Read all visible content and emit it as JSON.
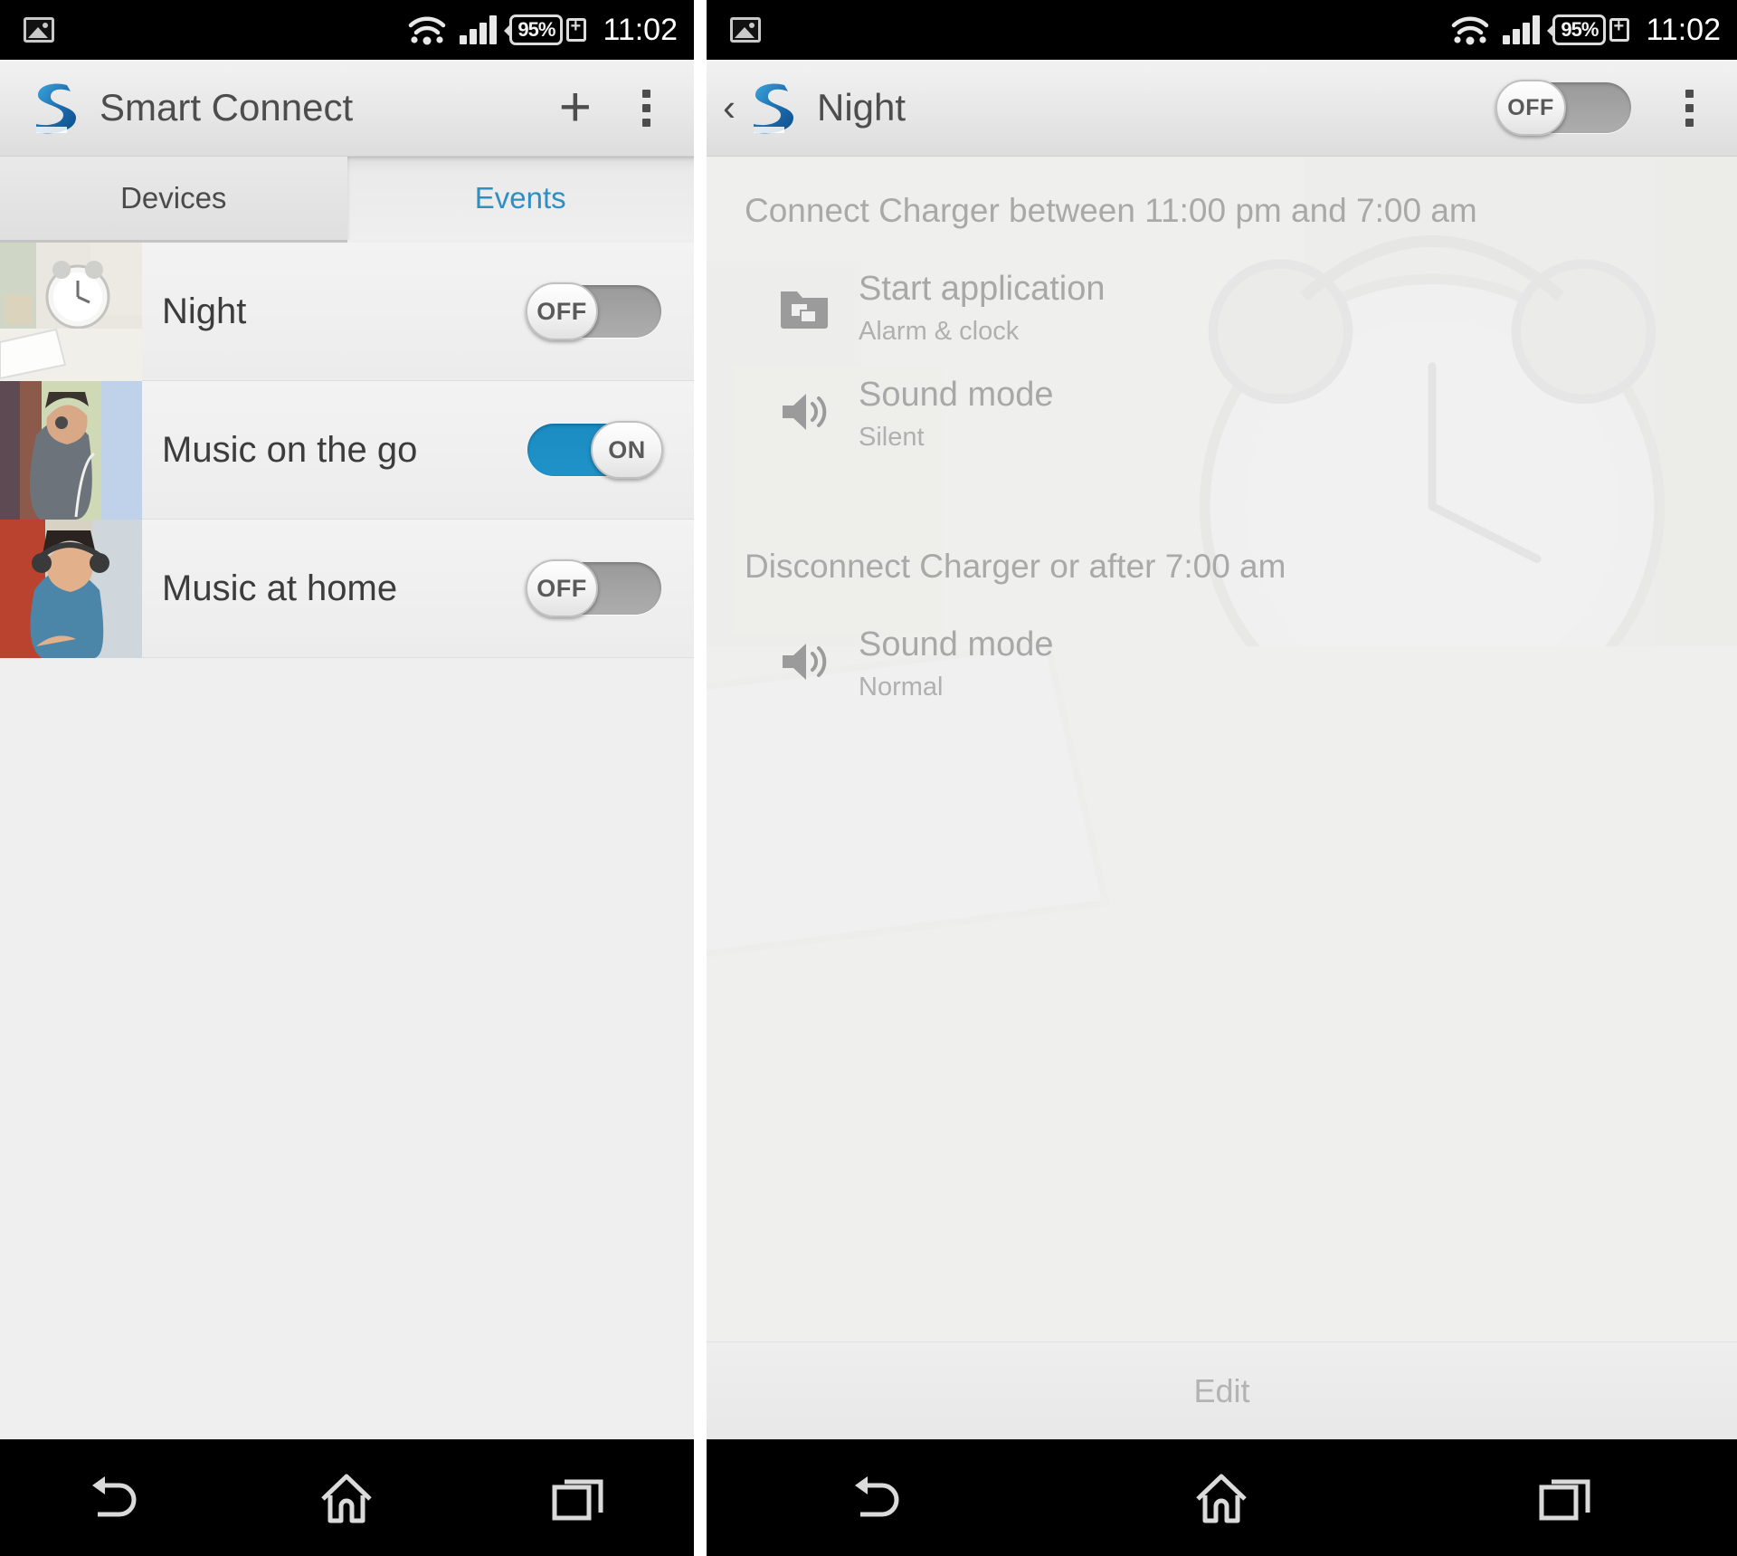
{
  "status_bar": {
    "photo_icon": "photo-icon",
    "wifi_icon": "wifi-icon",
    "signal_icon": "signal-icon",
    "battery_level": "95%",
    "battery_icon": "battery-charging-icon",
    "time": "11:02"
  },
  "left_screen": {
    "action_bar": {
      "app_icon": "smart-connect-logo",
      "title": "Smart Connect",
      "add_label": "+",
      "overflow_label": "more-options"
    },
    "tabs": [
      {
        "label": "Devices",
        "active": false
      },
      {
        "label": "Events",
        "active": true
      }
    ],
    "events": [
      {
        "name": "Night",
        "toggle_label": "OFF",
        "toggle_state": "off",
        "thumb": "alarm-clock-photo"
      },
      {
        "name": "Music on the go",
        "toggle_label": "ON",
        "toggle_state": "on",
        "thumb": "man-headphones-photo"
      },
      {
        "name": "Music at home",
        "toggle_label": "OFF",
        "toggle_state": "off",
        "thumb": "woman-headphones-photo"
      }
    ]
  },
  "right_screen": {
    "action_bar": {
      "back_label": "‹",
      "app_icon": "smart-connect-logo",
      "title": "Night",
      "toggle_label": "OFF",
      "toggle_state": "off",
      "overflow_label": "more-options"
    },
    "sections": [
      {
        "title": "Connect Charger between 11:00 pm and 7:00 am",
        "items": [
          {
            "icon": "start-application-icon",
            "primary": "Start application",
            "secondary": "Alarm & clock"
          },
          {
            "icon": "sound-mode-icon",
            "primary": "Sound mode",
            "secondary": "Silent"
          }
        ]
      },
      {
        "title": "Disconnect Charger or after 7:00 am",
        "items": [
          {
            "icon": "sound-mode-icon",
            "primary": "Sound mode",
            "secondary": "Normal"
          }
        ]
      }
    ],
    "edit_label": "Edit"
  },
  "nav_bar": {
    "back": "back-icon",
    "home": "home-icon",
    "recents": "recents-icon"
  },
  "colors": {
    "accent_blue": "#1f8fc6",
    "tab_active_text": "#2d8fc4",
    "toggle_off": "#9a9a9a",
    "status_bar_bg": "#000000"
  }
}
